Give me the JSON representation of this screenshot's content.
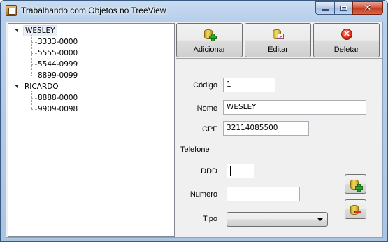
{
  "window": {
    "title": "Trabalhando com Objetos no TreeView"
  },
  "tree": {
    "nodes": [
      {
        "label": "WESLEY",
        "selected": true,
        "children": [
          "3333-0000",
          "5555-0000",
          "5544-0999",
          "8899-0099"
        ]
      },
      {
        "label": "RICARDO",
        "selected": false,
        "children": [
          "8888-0000",
          "9909-0098"
        ]
      }
    ]
  },
  "toolbar": {
    "add_label": "Adicionar",
    "edit_label": "Editar",
    "delete_label": "Deletar"
  },
  "form": {
    "codigo_label": "Código",
    "codigo_value": "1",
    "nome_label": "Nome",
    "nome_value": "WESLEY",
    "cpf_label": "CPF",
    "cpf_value": "32114085500"
  },
  "telefone": {
    "group_label": "Telefone",
    "ddd_label": "DDD",
    "ddd_value": "",
    "numero_label": "Numero",
    "numero_value": "",
    "tipo_label": "Tipo",
    "tipo_value": ""
  },
  "icons": {
    "add": "database-add-icon",
    "edit": "database-edit-icon",
    "delete": "delete-icon",
    "phone_add": "database-add-icon",
    "phone_remove": "database-remove-icon"
  }
}
